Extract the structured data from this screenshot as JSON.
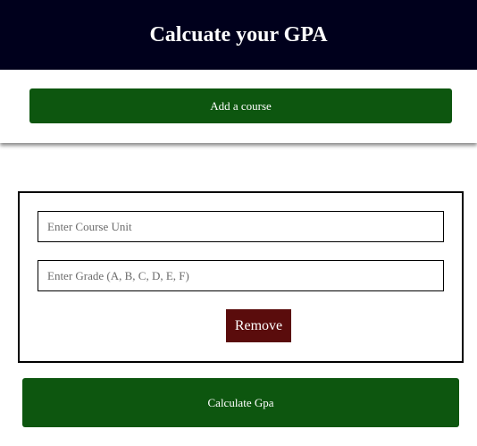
{
  "header": {
    "title": "Calcuate your GPA"
  },
  "actions": {
    "add_course_label": "Add a course",
    "calculate_label": "Calculate Gpa"
  },
  "course": {
    "unit_placeholder": "Enter Course Unit",
    "unit_value": "",
    "grade_placeholder": "Enter Grade (A, B, C, D, E, F)",
    "grade_value": "",
    "remove_label": "Remove"
  },
  "colors": {
    "header_bg": "#00001c",
    "primary_green": "#0d560f",
    "remove_red": "#5a0c0c"
  }
}
